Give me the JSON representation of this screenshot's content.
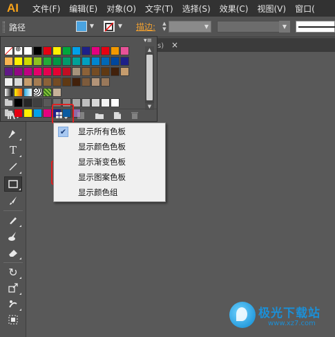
{
  "app": {
    "logo": "AI"
  },
  "menubar": {
    "items": [
      "文件(F)",
      "编辑(E)",
      "对象(O)",
      "文字(T)",
      "选择(S)",
      "效果(C)",
      "视图(V)",
      "窗口("
    ]
  },
  "control_bar": {
    "object_type": "路径",
    "stroke_label": "描边:"
  },
  "tab": {
    "fragment": "s)",
    "close": "×"
  },
  "colors": {
    "fill": "#4aa3df",
    "highlight": "#e02020",
    "logo": "#f7a21a"
  },
  "swatches": {
    "rows": [
      [
        "none",
        "reg",
        "#ffffff",
        "#000000",
        "#e60012",
        "#fff100",
        "#00a73c",
        "#00a0e9",
        "#1d2088",
        "#e4007f",
        "#e60012",
        "#f39800",
        "#e85298"
      ],
      [
        "#f8b551",
        "#fff100",
        "#cfdb00",
        "#8fc31f",
        "#22ac38",
        "#009944",
        "#009b6b",
        "#00a199",
        "#00a0c1",
        "#0086d1",
        "#0068b7",
        "#00479d",
        "#1d2088"
      ],
      [
        "#601986",
        "#920783",
        "#be0081",
        "#e5006a",
        "#e5004f",
        "#e60033",
        "#c30d23",
        "#a6937c",
        "#8c6239",
        "#754c24",
        "#603913",
        "#42210b",
        "#c69c6d"
      ],
      [
        "#f0f0f0",
        "#d9d9d9",
        "#c69c6d",
        "#a67c52",
        "#8c6239",
        "#754c24",
        "#603913",
        "#42210b",
        "#7d5b3c",
        "#b39478",
        "#99785a"
      ],
      [
        "grad-bw",
        "grad-orange",
        "grad-blue",
        "pattern-dots",
        "pattern-leaf",
        "#c7b299"
      ],
      [
        "folder",
        "#000000",
        "#262626",
        "#404040",
        "#595959",
        "#737373",
        "#8c8c8c",
        "#a6a6a6",
        "#bfbfbf",
        "#d9d9d9",
        "#f2f2f2",
        "#ffffff"
      ],
      [
        "folder",
        "#e60012",
        "#fff100",
        "#00a0e9",
        "#e4007f",
        "#1d2088",
        "#0b5ba0",
        "#8e6aa8"
      ]
    ]
  },
  "dropdown_menu": {
    "items": [
      {
        "label": "显示所有色板",
        "checked": true
      },
      {
        "label": "显示颜色色板",
        "checked": false
      },
      {
        "label": "显示渐变色板",
        "checked": false
      },
      {
        "label": "显示图案色板",
        "checked": false
      },
      {
        "label": "显示颜色组",
        "checked": false
      }
    ]
  },
  "tools": [
    "pen-tool-icon",
    "type-tool-icon",
    "line-tool-icon",
    "rectangle-tool-icon",
    "paintbrush-tool-icon",
    "pencil-tool-icon",
    "blob-brush-icon",
    "eraser-tool-icon",
    "rotate-tool-icon",
    "scale-tool-icon",
    "warp-tool-icon",
    "free-transform-icon"
  ],
  "watermark": {
    "brand": "极光下载站",
    "url": "www.xz7.com"
  }
}
